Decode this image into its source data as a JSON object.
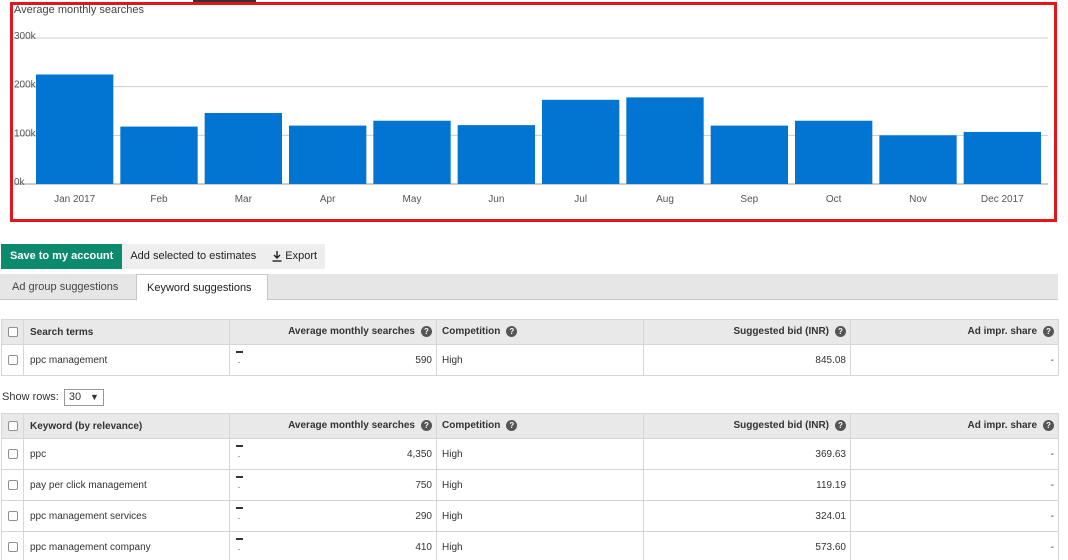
{
  "chart_data": {
    "type": "bar",
    "title": "Average monthly searches",
    "categories": [
      "Jan 2017",
      "Feb",
      "Mar",
      "Apr",
      "May",
      "Jun",
      "Jul",
      "Aug",
      "Sep",
      "Oct",
      "Nov",
      "Dec 2017"
    ],
    "values": [
      225000,
      118000,
      146000,
      120000,
      130000,
      121000,
      173000,
      178000,
      120000,
      130000,
      100000,
      107000
    ],
    "yticks": [
      "0k",
      "100k",
      "200k",
      "300k"
    ],
    "ylim": [
      0,
      300000
    ],
    "grid": true,
    "bar_color": "#0275d3"
  },
  "toolbar": {
    "save_label": "Save to my account",
    "add_label": "Add selected to estimates",
    "export_label": "Export"
  },
  "tabs": [
    {
      "label": "Ad group suggestions"
    },
    {
      "label": "Keyword suggestions"
    }
  ],
  "search_table": {
    "headers": [
      "Search terms",
      "Average monthly searches",
      "Competition",
      "Suggested bid (INR)",
      "Ad impr. share"
    ],
    "rows": [
      {
        "term": "ppc management",
        "avg": "590",
        "competition": "High",
        "bid": "845.08",
        "share": "-"
      }
    ]
  },
  "show_rows": {
    "label": "Show rows:",
    "value": "30"
  },
  "keyword_table": {
    "headers": [
      "Keyword (by relevance)",
      "Average monthly searches",
      "Competition",
      "Suggested bid (INR)",
      "Ad impr. share"
    ],
    "rows": [
      {
        "term": "ppc",
        "avg": "4,350",
        "competition": "High",
        "bid": "369.63",
        "share": "-"
      },
      {
        "term": "pay per click management",
        "avg": "750",
        "competition": "High",
        "bid": "119.19",
        "share": "-"
      },
      {
        "term": "ppc management services",
        "avg": "290",
        "competition": "High",
        "bid": "324.01",
        "share": "-"
      },
      {
        "term": "ppc management company",
        "avg": "410",
        "competition": "High",
        "bid": "573.60",
        "share": "-"
      }
    ]
  },
  "colors": {
    "accent_green": "#0b8a6e",
    "highlight_border": "#e0171c"
  }
}
